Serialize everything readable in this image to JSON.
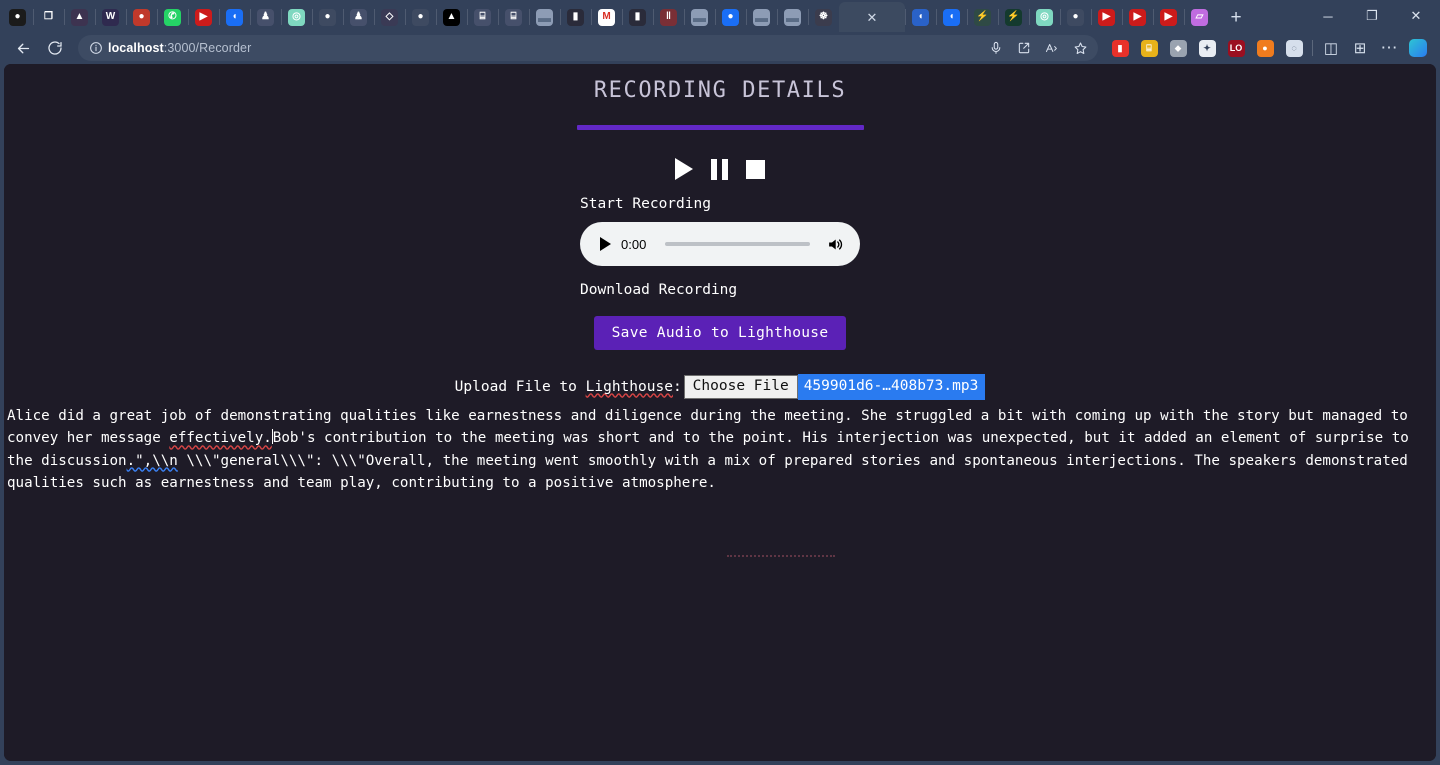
{
  "browser": {
    "tabs": [
      {
        "name": "tab-bear-app",
        "icon": "bear-icon",
        "color": "#1b1b1b",
        "glyph": "●",
        "active": false
      },
      {
        "name": "tab-layers",
        "icon": "layers-icon",
        "color": "#33415a",
        "glyph": "❐",
        "active": false
      },
      {
        "name": "tab-purple-flame",
        "icon": "flame-icon",
        "color": "#3d3350",
        "glyph": "▲",
        "active": false
      },
      {
        "name": "tab-w-logo",
        "icon": "w-logo-icon",
        "color": "#2f2a4f",
        "glyph": "W",
        "active": false
      },
      {
        "name": "tab-record",
        "icon": "record-icon",
        "color": "#c0392b",
        "glyph": "●",
        "active": false
      },
      {
        "name": "tab-whatsapp",
        "icon": "whatsapp-icon",
        "color": "#25d366",
        "glyph": "✆",
        "active": false
      },
      {
        "name": "tab-youtube",
        "icon": "youtube-icon",
        "color": "#cc1b1b",
        "glyph": "▶",
        "active": false
      },
      {
        "name": "tab-blue-drop",
        "icon": "blue-drop-icon",
        "color": "#1a6ef5",
        "glyph": "◖",
        "active": false
      },
      {
        "name": "tab-lighthouse-1",
        "icon": "lighthouse-icon",
        "color": "#46506b",
        "glyph": "♟",
        "active": false
      },
      {
        "name": "tab-teal-fingerprint",
        "icon": "fingerprint-icon",
        "color": "#7fd8c0",
        "glyph": "◎",
        "active": false
      },
      {
        "name": "tab-github-1",
        "icon": "github-icon",
        "color": "#3e4a61",
        "glyph": "●",
        "active": false
      },
      {
        "name": "tab-lighthouse-2",
        "icon": "lighthouse-icon",
        "color": "#46506b",
        "glyph": "♟",
        "active": false
      },
      {
        "name": "tab-ethereum",
        "icon": "ethereum-icon",
        "color": "#3a3a55",
        "glyph": "◇",
        "active": false
      },
      {
        "name": "tab-github-2",
        "icon": "github-icon",
        "color": "#3e4a61",
        "glyph": "●",
        "active": false
      },
      {
        "name": "tab-vercel",
        "icon": "vercel-icon",
        "color": "#000000",
        "glyph": "▲",
        "active": false
      },
      {
        "name": "tab-doc-1",
        "icon": "document-icon",
        "color": "#46506b",
        "glyph": "⌸",
        "active": false
      },
      {
        "name": "tab-doc-2",
        "icon": "document-icon",
        "color": "#46506b",
        "glyph": "⌸",
        "active": false
      },
      {
        "name": "tab-folder-1",
        "icon": "folder-icon",
        "color": "#8d9cb5",
        "glyph": "▬",
        "active": false
      },
      {
        "name": "tab-dark-person",
        "icon": "person-icon",
        "color": "#2a2b3a",
        "glyph": "▮",
        "active": false
      },
      {
        "name": "tab-gmail",
        "icon": "gmail-icon",
        "color": "#ffffff",
        "glyph": "M",
        "active": false
      },
      {
        "name": "tab-dark-person-2",
        "icon": "person-icon",
        "color": "#2a2b3a",
        "glyph": "▮",
        "active": false
      },
      {
        "name": "tab-notion",
        "icon": "notion-icon",
        "color": "#7a2f36",
        "glyph": "‖",
        "active": false
      },
      {
        "name": "tab-folder-2",
        "icon": "folder-icon",
        "color": "#8d9cb5",
        "glyph": "▬",
        "active": false
      },
      {
        "name": "tab-blue-circle",
        "icon": "circle-icon",
        "color": "#1a6ef5",
        "glyph": "●",
        "active": false
      },
      {
        "name": "tab-folder-3",
        "icon": "folder-icon",
        "color": "#8d9cb5",
        "glyph": "▬",
        "active": false
      },
      {
        "name": "tab-folder-4",
        "icon": "folder-icon",
        "color": "#8d9cb5",
        "glyph": "▬",
        "active": false
      },
      {
        "name": "tab-globe-dark",
        "icon": "globe-icon",
        "color": "#3b3c4d",
        "glyph": "☸",
        "active": false
      },
      {
        "name": "tab-recorder",
        "icon": "close-icon",
        "color": "",
        "glyph": "",
        "active": true
      },
      {
        "name": "tab-blue-drop-2",
        "icon": "blue-drop-icon",
        "color": "#2a62c8",
        "glyph": "◖",
        "active": false
      },
      {
        "name": "tab-blue-drop-3",
        "icon": "blue-drop-icon",
        "color": "#1a6ef5",
        "glyph": "◖",
        "active": false
      },
      {
        "name": "tab-bolt-1",
        "icon": "bolt-icon",
        "color": "#2f4a45",
        "glyph": "⚡",
        "active": false
      },
      {
        "name": "tab-bolt-2",
        "icon": "bolt-icon",
        "color": "#143a2e",
        "glyph": "⚡",
        "active": false
      },
      {
        "name": "tab-teal-swirl",
        "icon": "swirl-icon",
        "color": "#7fd8c0",
        "glyph": "◎",
        "active": false
      },
      {
        "name": "tab-github-3",
        "icon": "github-icon",
        "color": "#3e4a61",
        "glyph": "●",
        "active": false
      },
      {
        "name": "tab-youtube-2",
        "icon": "youtube-icon",
        "color": "#cc1b1b",
        "glyph": "▶",
        "active": false
      },
      {
        "name": "tab-youtube-3",
        "icon": "youtube-icon",
        "color": "#cc1b1b",
        "glyph": "▶",
        "active": false
      },
      {
        "name": "tab-youtube-4",
        "icon": "youtube-icon",
        "color": "#cc1b1b",
        "glyph": "▶",
        "active": false
      },
      {
        "name": "tab-purple-panel",
        "icon": "panel-icon",
        "color": "#c06ce0",
        "glyph": "▱",
        "active": false
      }
    ],
    "new_tab_label": "+",
    "window_controls": {
      "minimize": "─",
      "maximize": "❐",
      "close": "✕"
    },
    "nav": {
      "back": "←",
      "reload": "⟳",
      "info": "ⓘ"
    },
    "url": {
      "host": "localhost",
      "path": ":3000/Recorder"
    },
    "url_actions": [
      {
        "name": "microphone-icon",
        "glyph": "ᵕ"
      },
      {
        "name": "share-icon",
        "glyph": "↗"
      },
      {
        "name": "read-aloud-icon",
        "glyph": "Aᵛ"
      },
      {
        "name": "favorite-star-icon",
        "glyph": "☆"
      }
    ],
    "extensions": [
      {
        "name": "extension-red-pill",
        "color": "#e8312a",
        "glyph": "▮"
      },
      {
        "name": "extension-yellow-box",
        "color": "#e8b21a",
        "glyph": "⌸"
      },
      {
        "name": "extension-grey-pin",
        "color": "#9aa3b0",
        "glyph": "⬥"
      },
      {
        "name": "extension-white-card",
        "color": "#e9edf3",
        "glyph": "✦"
      },
      {
        "name": "extension-lo-badge",
        "color": "#9b0f20",
        "glyph": "LO"
      },
      {
        "name": "extension-fox",
        "color": "#f07c1e",
        "glyph": "●"
      },
      {
        "name": "extension-ghost",
        "color": "#d6dfec",
        "glyph": "◌"
      },
      {
        "name": "split-screen-icon",
        "color": "#d6dfec",
        "glyph": "◫"
      },
      {
        "name": "collections-icon",
        "color": "#d6dfec",
        "glyph": "⊞"
      },
      {
        "name": "settings-more-icon",
        "color": "#d6dfec",
        "glyph": "⋯"
      },
      {
        "name": "copilot-icon",
        "color": "#2ec5d3",
        "glyph": "◨"
      }
    ]
  },
  "page": {
    "title": "RECORDING DETAILS",
    "transport": {
      "play_label": "play",
      "pause_label": "pause",
      "stop_label": "stop"
    },
    "start_recording_label": "Start Recording",
    "audio": {
      "time": "0:00",
      "play_label": "play",
      "volume_label": "volume"
    },
    "download_recording_label": "Download Recording",
    "save_button_label": "Save Audio to Lighthouse",
    "upload": {
      "label_prefix": "Upload File to ",
      "label_spell": "Lighthouse",
      "label_suffix": ":",
      "choose_file_label": "Choose File",
      "file_name": "459901d6-…408b73.mp3"
    },
    "transcript": {
      "part1": "Alice did a great job of demonstrating qualities like earnestness and diligence during the meeting. She struggled a bit with coming up with the story but managed to convey her message ",
      "spell1": "effectively.",
      "part2": "Bob's contribution to the meeting was short and to the point. His interjection was unexpected, but it added an element of surprise to the discussion",
      "grammar1": ".\",\\\\n",
      "part3": " \\\\\\\"general\\\\\\\": \\\\\\\"Overall, the meeting went smoothly with a mix of prepared stories and spontaneous interjections. The speakers demonstrated qualities such as earnestness and team play, contributing to a positive atmosphere."
    }
  },
  "colors": {
    "page_background": "#1e1b27",
    "browser_chrome": "#33415a",
    "accent_purple": "#6228c7",
    "button_purple": "#5b21b6",
    "selection_blue": "#2a7bf0",
    "title_text": "#c8c4d8"
  }
}
